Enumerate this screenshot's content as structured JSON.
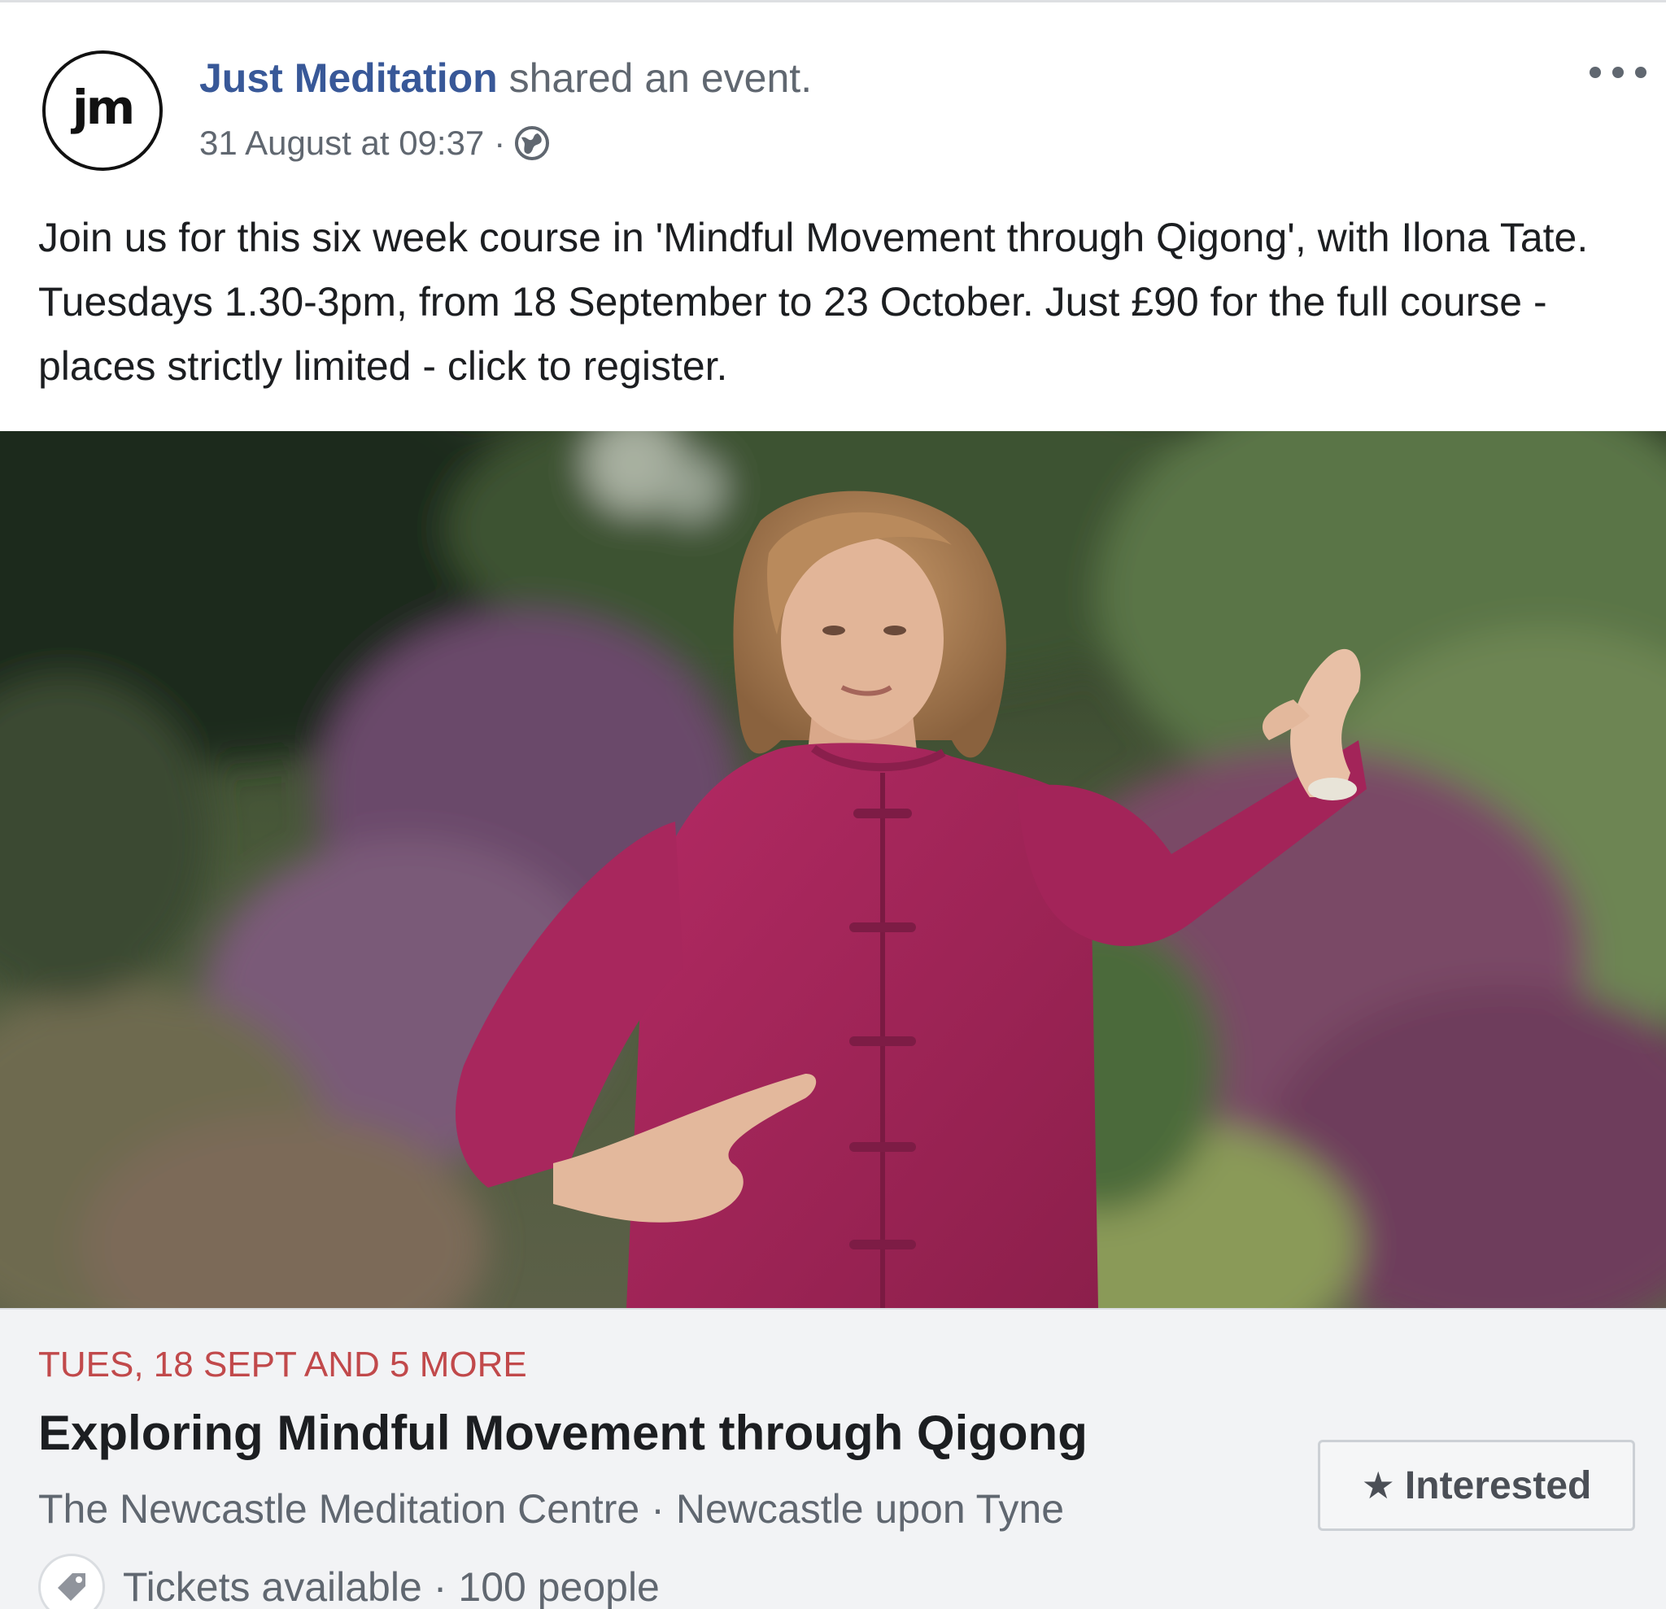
{
  "post": {
    "author": {
      "avatar_text": "jm",
      "name": "Just Meditation",
      "action": "shared an event."
    },
    "timestamp": "31 August at 09:37",
    "meta_separator": "·",
    "privacy_icon": "globe-icon",
    "more_icon": "more-options-icon",
    "text": "Join us for this six week course in 'Mindful Movement through Qigong', with Ilona Tate. Tuesdays 1.30-3pm, from 18 September to 23 October. Just £90 for the full course - places strictly limited - click to register."
  },
  "event": {
    "date": "TUES, 18 SEPT AND 5 MORE",
    "title": "Exploring Mindful Movement through Qigong",
    "venue": "The Newcastle Meditation Centre",
    "city": "Newcastle upon Tyne",
    "separator": "·",
    "tickets": "Tickets available",
    "people": "100 people",
    "ticket_icon": "ticket-icon",
    "interested_icon": "star-icon",
    "interested_label": "Interested"
  },
  "colors": {
    "link": "#385898",
    "date": "#c1494b",
    "secondary": "#606770",
    "card_bg": "#f2f3f5",
    "shirt": "#a3245a"
  }
}
